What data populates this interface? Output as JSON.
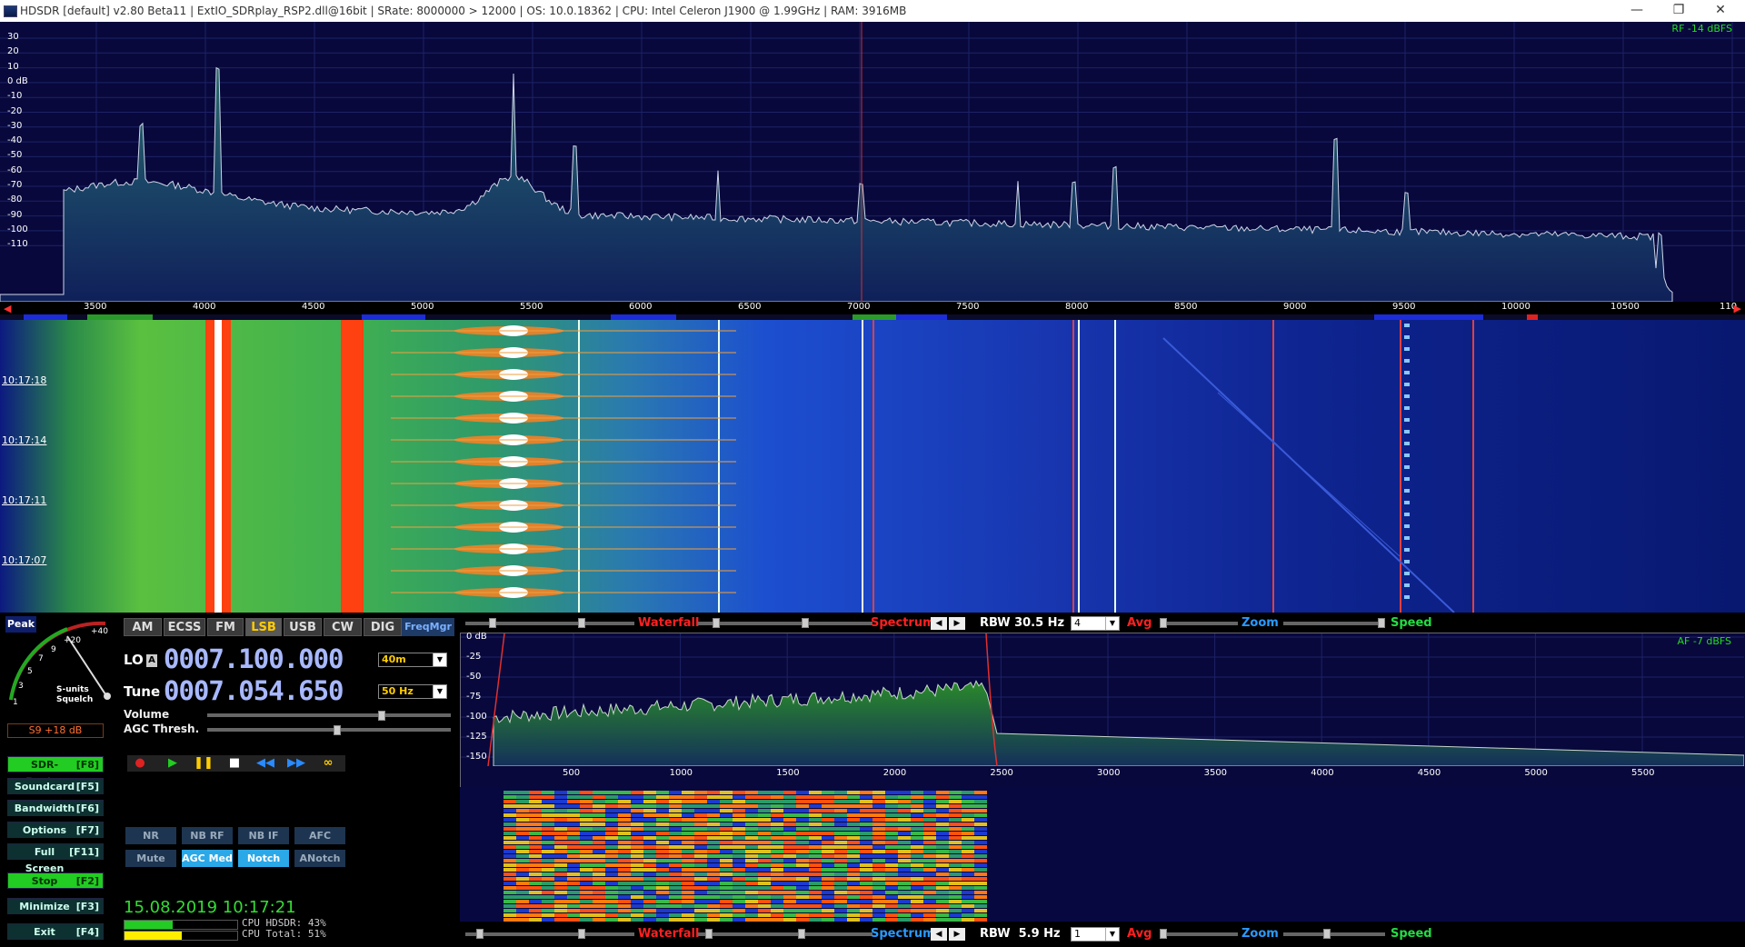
{
  "window": {
    "title": "HDSDR  [default]  v2.80 Beta11  |  ExtIO_SDRplay_RSP2.dll@16bit  |  SRate: 8000000 > 12000  |  OS: 10.0.18362   |  CPU: Intel Celeron  J1900  @ 1.99GHz  |  RAM: 3916MB",
    "controls": [
      "—",
      "❐",
      "✕"
    ]
  },
  "rf_spectrum": {
    "level_label": "RF -14 dBFS",
    "db_ticks": [
      "30",
      "20",
      "10",
      "0 dB",
      "-10",
      "-20",
      "-30",
      "-40",
      "-50",
      "-60",
      "-70",
      "-80",
      "-90",
      "-100",
      "-110"
    ],
    "freq_ticks": [
      "3500",
      "4000",
      "4500",
      "5000",
      "5500",
      "6000",
      "6500",
      "7000",
      "7500",
      "8000",
      "8500",
      "9000",
      "9500",
      "10000",
      "10500",
      "110"
    ]
  },
  "waterfall": {
    "timestamps": [
      "10:17:18",
      "10:17:14",
      "10:17:11",
      "10:17:07"
    ]
  },
  "smeter": {
    "peak_label": "Peak",
    "scale": [
      "1",
      "3",
      "5",
      "7",
      "9",
      "+20",
      "+40"
    ],
    "caption_line1": "S-units",
    "caption_line2": "Squelch",
    "reading": "S9 +18 dB"
  },
  "modes": [
    "AM",
    "ECSS",
    "FM",
    "LSB",
    "USB",
    "CW",
    "DIG"
  ],
  "active_mode": "LSB",
  "freqmgr_label": "FreqMgr",
  "lo": {
    "label": "LO",
    "badge": "A",
    "value": "0007.100.000",
    "band": "40m"
  },
  "tune": {
    "label": "Tune",
    "value": "0007.054.650",
    "step": "50 Hz"
  },
  "sliders": {
    "volume_label": "Volume",
    "agc_label": "AGC Thresh.",
    "volume_level": 0.7,
    "agc_level": 0.52
  },
  "side_buttons": [
    {
      "label": "SDR-Device",
      "key": "[F8]",
      "green": true
    },
    {
      "label": "Soundcard",
      "key": "[F5]",
      "green": false
    },
    {
      "label": "Bandwidth",
      "key": "[F6]",
      "green": false
    },
    {
      "label": "Options",
      "key": "[F7]",
      "green": false
    },
    {
      "label": "Full Screen",
      "key": "[F11]",
      "green": false
    },
    {
      "label": "Stop",
      "key": "[F2]",
      "green": true
    },
    {
      "label": "Minimize",
      "key": "[F3]",
      "green": false
    },
    {
      "label": "Exit",
      "key": "[F4]",
      "green": false
    }
  ],
  "transport": [
    "record-icon",
    "play-icon",
    "pause-icon",
    "stop-icon",
    "rewind-icon",
    "forward-icon",
    "loop-icon"
  ],
  "dsp_buttons": [
    {
      "label": "NR",
      "on": false
    },
    {
      "label": "NB RF",
      "on": false
    },
    {
      "label": "NB IF",
      "on": false
    },
    {
      "label": "AFC",
      "on": false
    },
    {
      "label": "Mute",
      "on": false
    },
    {
      "label": "AGC Med",
      "on": true
    },
    {
      "label": "Notch",
      "on": true
    },
    {
      "label": "ANotch",
      "on": false
    }
  ],
  "datetime": "15.08.2019 10:17:21",
  "cpu": {
    "hdsdr": "CPU HDSDR: 43%",
    "total": "CPU Total: 51%",
    "hdsdr_level": 0.43,
    "total_level": 0.51
  },
  "rf_toolbar": {
    "waterfall": "Waterfall",
    "spectrum": "Spectrum",
    "rbw": "RBW 30.5 Hz",
    "avg_value": "4",
    "avg": "Avg",
    "zoom": "Zoom",
    "speed": "Speed"
  },
  "af_spectrum": {
    "level_label": "AF -7 dBFS",
    "db_ticks": [
      "0 dB",
      "-25",
      "-50",
      "-75",
      "-100",
      "-125",
      "-150"
    ],
    "freq_ticks": [
      "500",
      "1000",
      "1500",
      "2000",
      "2500",
      "3000",
      "3500",
      "4000",
      "4500",
      "5000",
      "5500"
    ]
  },
  "af_toolbar": {
    "waterfall": "Waterfall",
    "spectrum": "Spectrum",
    "rbw": "RBW  5.9 Hz",
    "avg_value": "1",
    "avg": "Avg",
    "zoom": "Zoom",
    "speed": "Speed"
  },
  "colors": {
    "spectrum_bg": "#08083c",
    "accent_green": "#33dd33",
    "accent_red": "#ff2020",
    "freq_blue": "#a8b8ff"
  }
}
